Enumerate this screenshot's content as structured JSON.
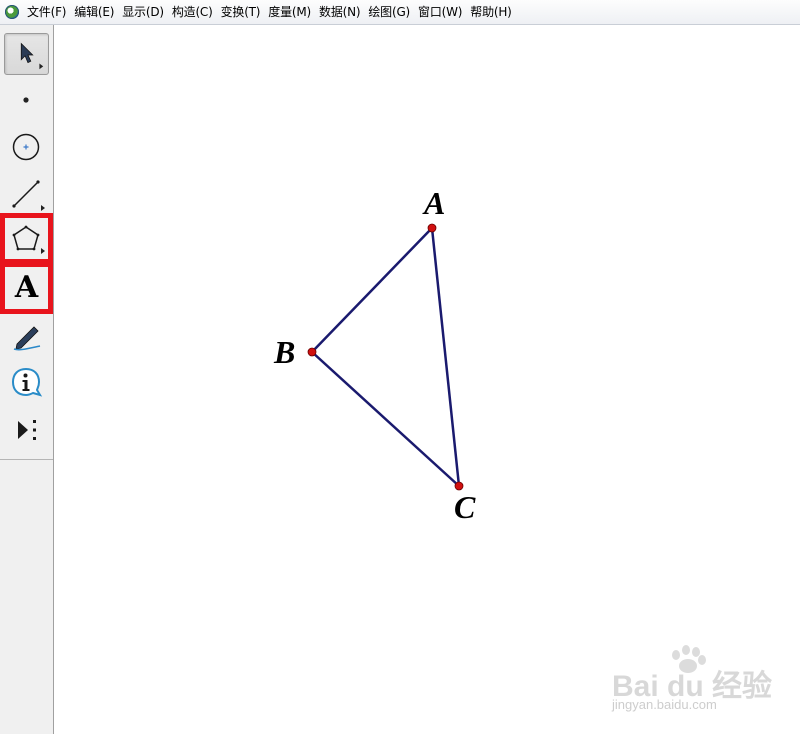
{
  "menubar": {
    "items": [
      {
        "label": "文件(F)"
      },
      {
        "label": "编辑(E)"
      },
      {
        "label": "显示(D)"
      },
      {
        "label": "构造(C)"
      },
      {
        "label": "变换(T)"
      },
      {
        "label": "度量(M)"
      },
      {
        "label": "数据(N)"
      },
      {
        "label": "绘图(G)"
      },
      {
        "label": "窗口(W)"
      },
      {
        "label": "帮助(H)"
      }
    ]
  },
  "toolbar": {
    "tools": [
      {
        "icon": "arrow-select-icon",
        "selected": true
      },
      {
        "icon": "point-icon"
      },
      {
        "icon": "compass-icon"
      },
      {
        "icon": "straightedge-icon"
      },
      {
        "icon": "polygon-icon",
        "highlighted": true
      },
      {
        "icon": "text-icon",
        "label": "A",
        "highlighted": true
      },
      {
        "icon": "marker-pen-icon"
      },
      {
        "icon": "information-icon"
      },
      {
        "icon": "custom-tool-icon"
      }
    ]
  },
  "canvas": {
    "points": [
      {
        "label": "A"
      },
      {
        "label": "B"
      },
      {
        "label": "C"
      }
    ],
    "colors": {
      "segment": "#1a1a6e",
      "point": "#d01010"
    }
  },
  "watermark": {
    "main": "Bai du 经验",
    "sub": "jingyan.baidu.com"
  }
}
